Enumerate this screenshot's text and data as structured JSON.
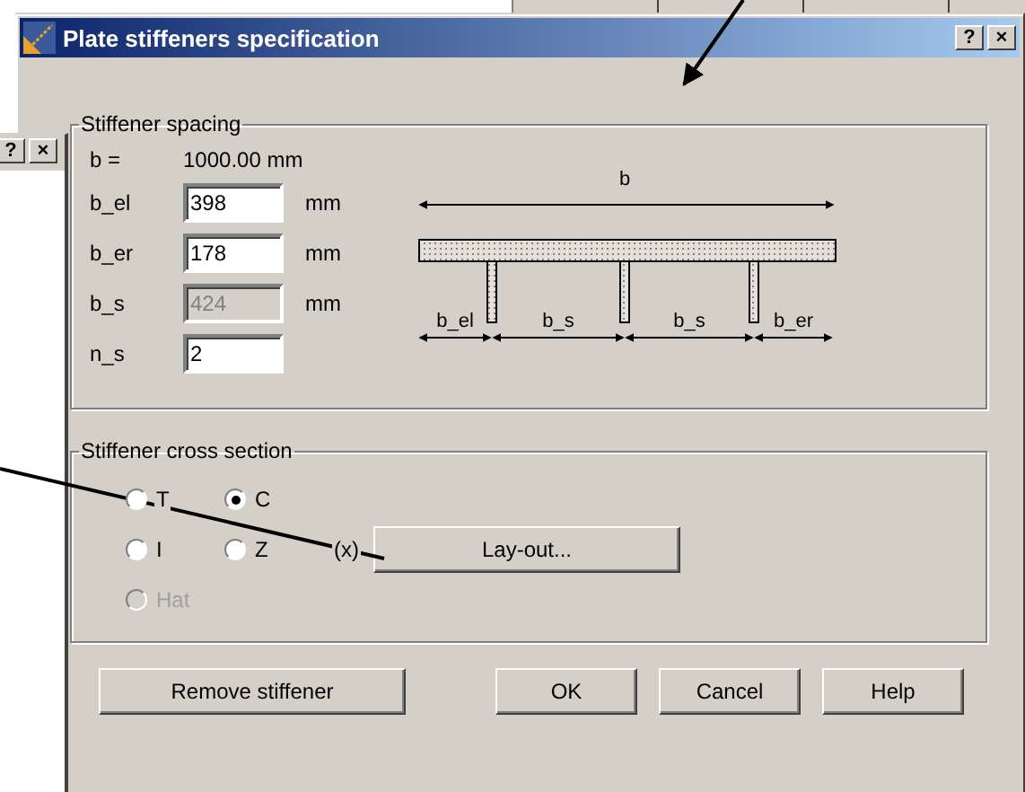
{
  "background_window": {
    "buttons": [
      "?",
      "×"
    ]
  },
  "dialog": {
    "title": "Plate stiffeners specification",
    "title_buttons": [
      "?",
      "×"
    ]
  },
  "stiffener_spacing": {
    "legend": "Stiffener spacing",
    "b": {
      "label": "b =",
      "value": "1000.00 mm"
    },
    "fields": [
      {
        "label": "b_el",
        "value": "398",
        "unit": "mm",
        "disabled": false
      },
      {
        "label": "b_er",
        "value": "178",
        "unit": "mm",
        "disabled": false
      },
      {
        "label": "b_s",
        "value": "424",
        "unit": "mm",
        "disabled": true
      },
      {
        "label": "n_s",
        "value": "2",
        "disabled": false
      }
    ],
    "diagram": {
      "width_label": "b",
      "dimension_labels": [
        "b_el",
        "b_s",
        "b_s",
        "b_er"
      ]
    }
  },
  "cross_section": {
    "legend": "Stiffener cross section",
    "options": [
      {
        "label": "T",
        "selected": false,
        "disabled": false
      },
      {
        "label": "C",
        "selected": true,
        "disabled": false
      },
      {
        "label": "I",
        "selected": false,
        "disabled": false
      },
      {
        "label": "Z",
        "selected": false,
        "disabled": false
      },
      {
        "label": "Hat",
        "selected": false,
        "disabled": true
      }
    ],
    "note": "(x)",
    "layout_button": "Lay-out..."
  },
  "buttons": [
    "Remove stiffener",
    "OK",
    "Cancel",
    "Help"
  ]
}
